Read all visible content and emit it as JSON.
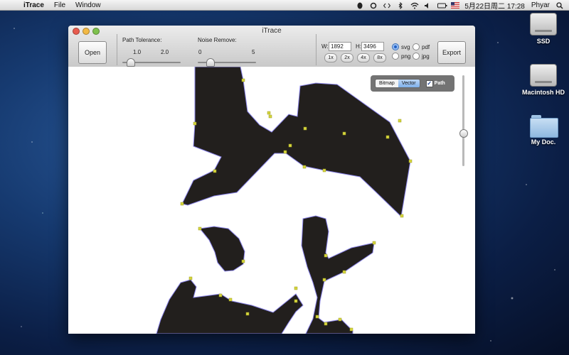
{
  "menubar": {
    "app_name": "iTrace",
    "items": [
      "File",
      "Window"
    ],
    "clock": "5月22日周二  17:28",
    "user": "Phyar"
  },
  "desktop": {
    "icons": [
      {
        "label": "SSD",
        "type": "drive"
      },
      {
        "label": "Macintosh HD",
        "type": "drive"
      },
      {
        "label": "My Doc.",
        "type": "folder"
      }
    ]
  },
  "window": {
    "title": "iTrace",
    "open_label": "Open",
    "path_tolerance": {
      "label": "Path Tolerance:",
      "min": "1.0",
      "max": "2.0"
    },
    "noise_remove": {
      "label": "Noise Remove:",
      "min": "0",
      "max": "5"
    },
    "width": {
      "label": "W:",
      "value": "1892"
    },
    "height": {
      "label": "H:",
      "value": "3496"
    },
    "zoom": [
      "1x",
      "2x",
      "4x",
      "8x"
    ],
    "formats": [
      {
        "label": "svg",
        "selected": true
      },
      {
        "label": "pdf",
        "selected": false
      },
      {
        "label": "png",
        "selected": false
      },
      {
        "label": "jpg",
        "selected": false
      }
    ],
    "export_label": "Export",
    "view_mode": {
      "options": [
        "Bitmap",
        "Vector"
      ],
      "selected": "Vector"
    },
    "path_checkbox": {
      "label": "Path",
      "checked": true
    }
  }
}
